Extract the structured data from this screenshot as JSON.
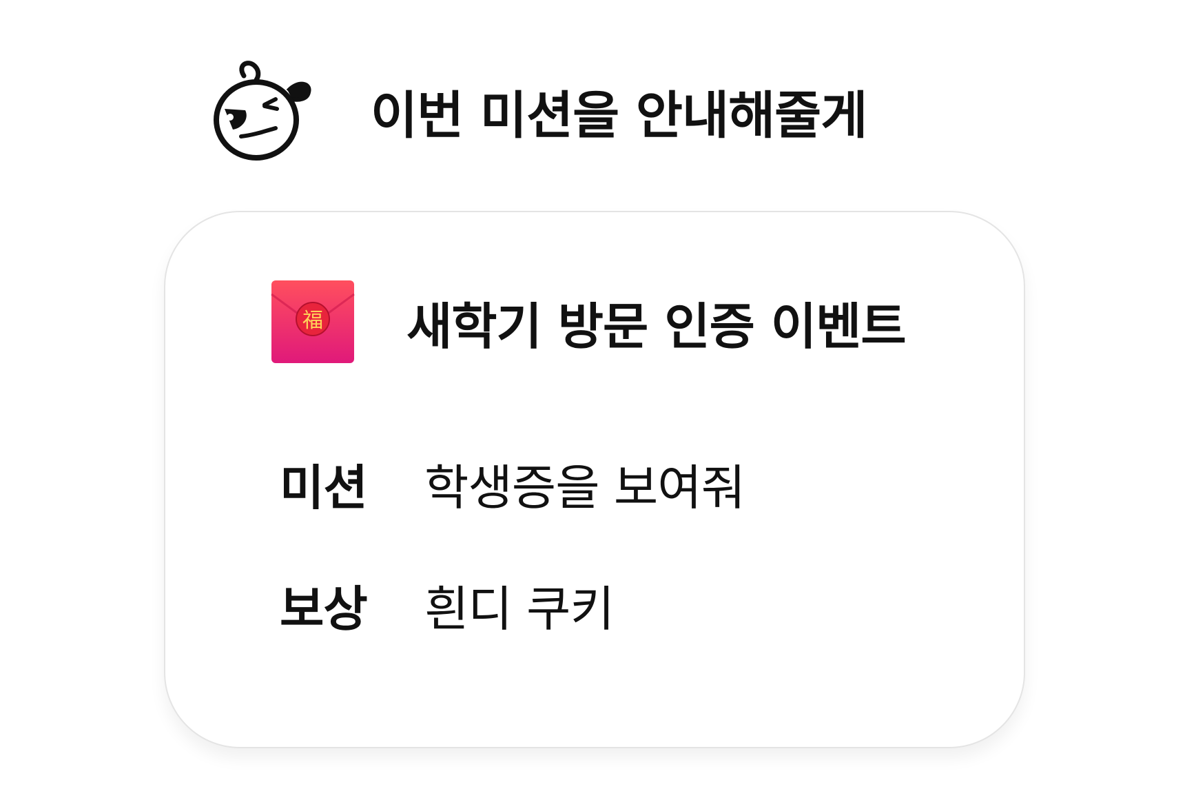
{
  "header": {
    "mascot_icon": "winking-dog-mascot-icon",
    "title": "이번 미션을 안내해줄게"
  },
  "event": {
    "icon": "red-envelope-icon",
    "envelope_glyph": "福",
    "title": "새학기 방문 인증 이벤트",
    "mission": {
      "label": "미션",
      "value": "학생증을 보여줘"
    },
    "reward": {
      "label": "보상",
      "value": "흰디 쿠키"
    }
  },
  "colors": {
    "envelope_top": "#ff4f5e",
    "envelope_bottom": "#e0197a",
    "seal": "#e8243c",
    "seal_glyph": "#ffd35a",
    "text": "#111111",
    "card_border": "#e4e4e4"
  }
}
